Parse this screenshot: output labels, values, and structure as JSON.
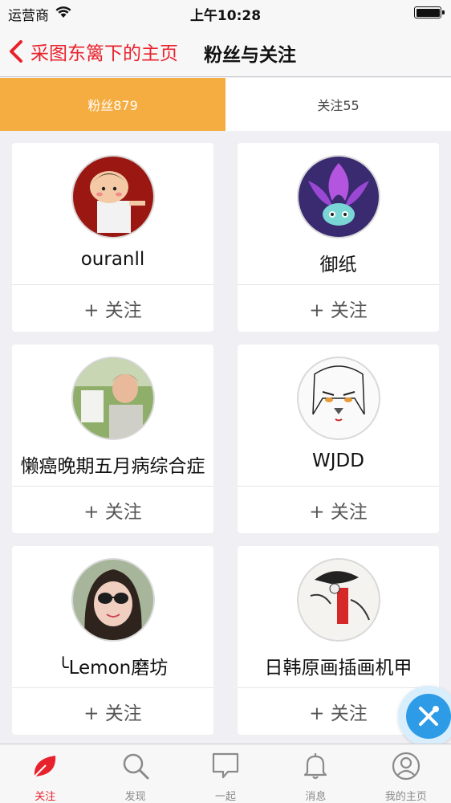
{
  "status_bar": {
    "carrier": "运营商",
    "time": "上午10:28"
  },
  "nav": {
    "back_label": "采图东篱下的主页",
    "title": "粉丝与关注"
  },
  "tabs": [
    {
      "label": "粉丝879",
      "active": true
    },
    {
      "label": "关注55",
      "active": false
    }
  ],
  "users": [
    {
      "name": "ouranll",
      "follow_label": "+ 关注",
      "avatar": "girl-red-avatar"
    },
    {
      "name": "御纸",
      "follow_label": "+ 关注",
      "avatar": "purple-creature-avatar"
    },
    {
      "name": "懒癌晚期五月病综合症",
      "follow_label": "+ 关注",
      "avatar": "painter-outdoor-avatar"
    },
    {
      "name": "WJDD",
      "follow_label": "+ 关注",
      "avatar": "sketch-girl-avatar"
    },
    {
      "name": "╰Lemon磨坊",
      "follow_label": "+ 关注",
      "avatar": "sunglasses-girl-avatar"
    },
    {
      "name": "日韩原画插画机甲",
      "follow_label": "+ 关注",
      "avatar": "ink-illustration-avatar"
    }
  ],
  "tab_bar": [
    {
      "label": "关注",
      "icon": "leaf-icon",
      "active": true
    },
    {
      "label": "发现",
      "icon": "search-icon",
      "active": false
    },
    {
      "label": "一起",
      "icon": "chat-bubble-icon",
      "active": false
    },
    {
      "label": "消息",
      "icon": "bell-icon",
      "active": false
    },
    {
      "label": "我的主页",
      "icon": "user-icon",
      "active": false
    }
  ],
  "colors": {
    "accent": "#e8222c",
    "tab_active": "#f5ad41",
    "fab": "#2d9be6"
  }
}
